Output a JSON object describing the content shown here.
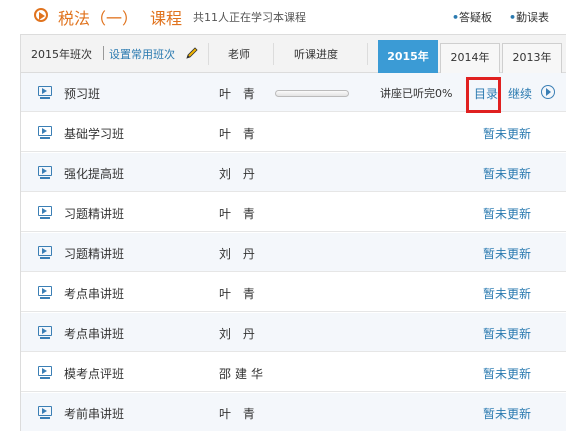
{
  "top": {
    "course_name": "税法（一）",
    "course_word": "课程",
    "learners_text": "共11人正在学习本课程",
    "links": [
      {
        "dot": "•",
        "label": "答疑板"
      },
      {
        "dot": "•",
        "label": "勤误表"
      }
    ]
  },
  "header": {
    "year_class": "2015年班次",
    "set_common": "设置常用班次",
    "teacher_col": "老师",
    "progress_col": "听课进度",
    "year_tabs": [
      "2015年",
      "2014年",
      "2013年"
    ],
    "active_year": "2015年"
  },
  "rows": [
    {
      "name": "预习班",
      "teacher": "叶 青",
      "progress_text": "讲座已听完0%",
      "progress_fraction": 0,
      "catalog": "目录",
      "continue": "继续"
    },
    {
      "name": "基础学习班",
      "teacher": "叶 青",
      "status": "暂未更新"
    },
    {
      "name": "强化提高班",
      "teacher": "刘 丹",
      "status": "暂未更新"
    },
    {
      "name": "习题精讲班",
      "teacher": "叶 青",
      "status": "暂未更新"
    },
    {
      "name": "习题精讲班",
      "teacher": "刘 丹",
      "status": "暂未更新"
    },
    {
      "name": "考点串讲班",
      "teacher": "叶 青",
      "status": "暂未更新"
    },
    {
      "name": "考点串讲班",
      "teacher": "刘 丹",
      "status": "暂未更新"
    },
    {
      "name": "模考点评班",
      "teacher": "邵建华",
      "status": "暂未更新"
    },
    {
      "name": "考前串讲班",
      "teacher": "叶 青",
      "status": "暂未更新"
    }
  ],
  "colors": {
    "accent_orange": "#e0731e",
    "link_blue": "#2a7ab0",
    "tab_active": "#3b9bd5",
    "highlight_red": "#e02020"
  }
}
